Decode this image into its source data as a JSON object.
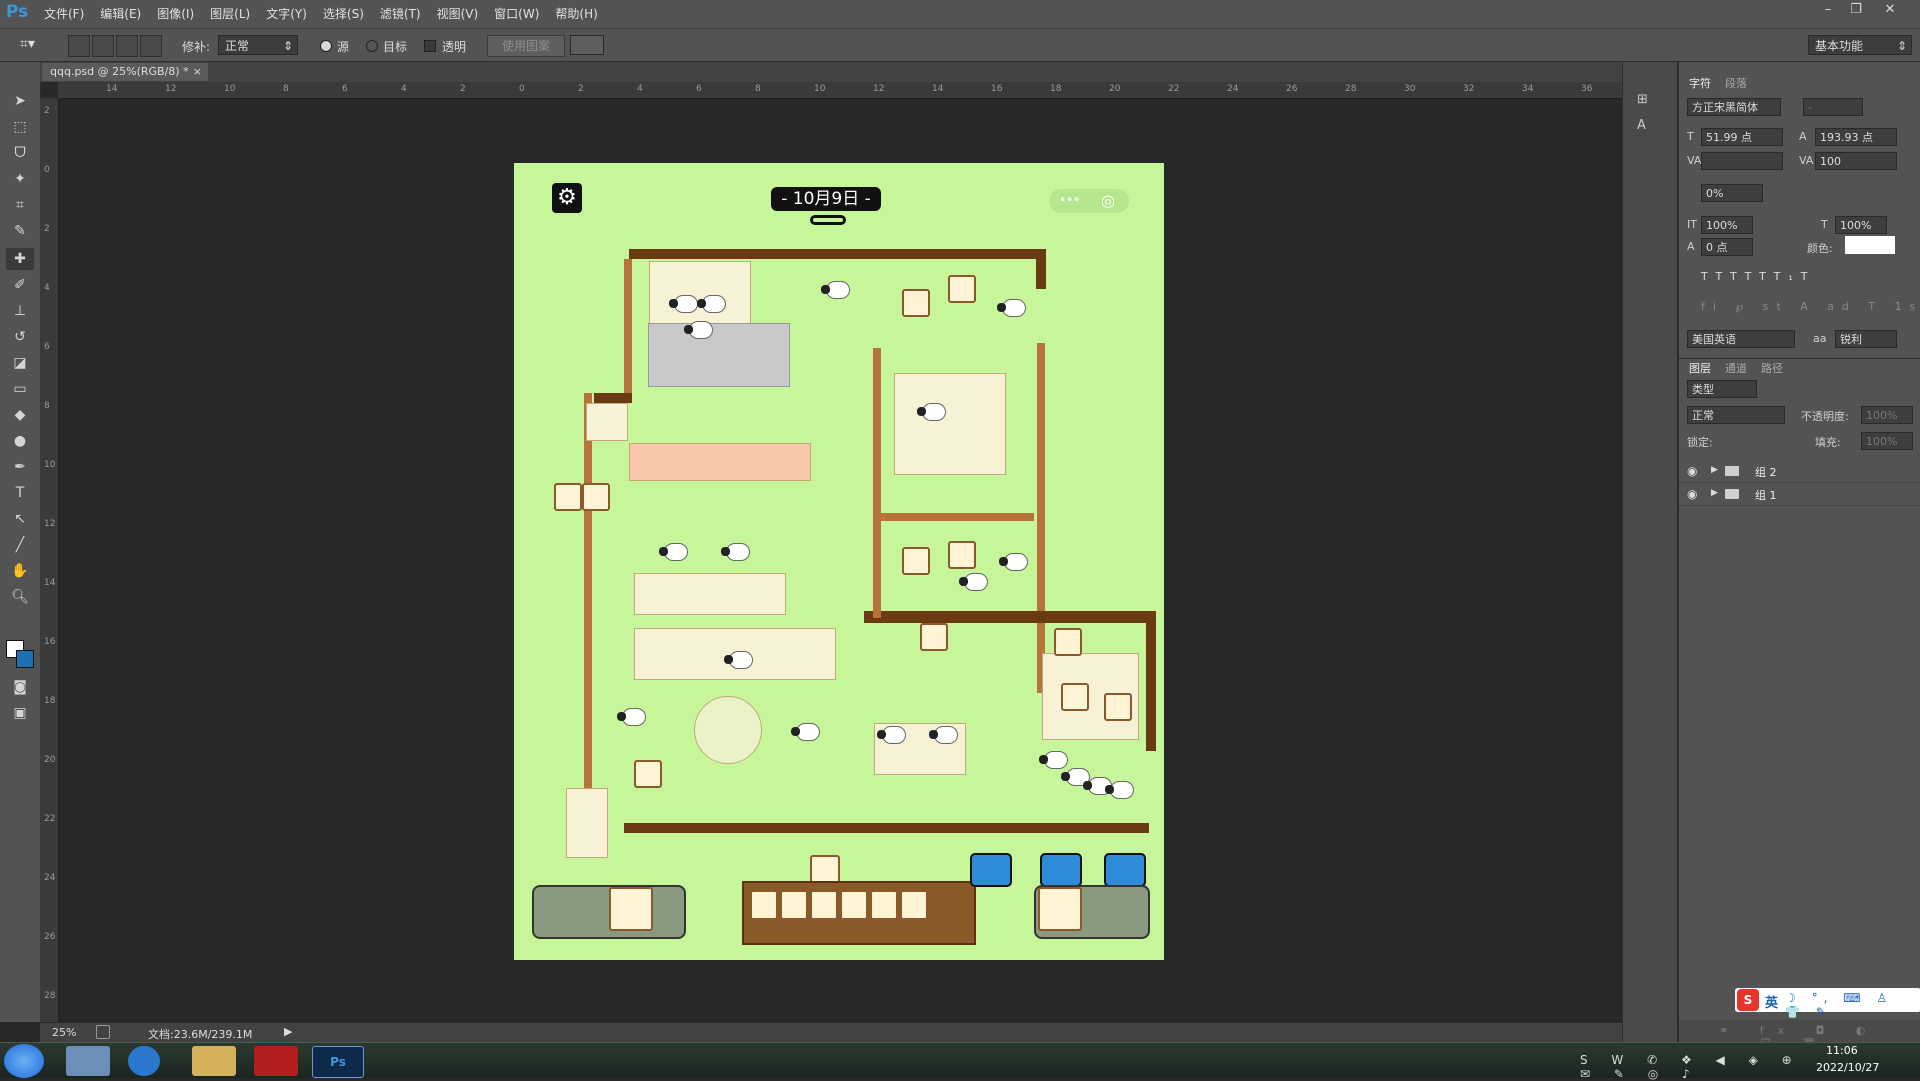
{
  "app": {
    "logo": "Ps",
    "menus": [
      "文件(F)",
      "编辑(E)",
      "图像(I)",
      "图层(L)",
      "文字(Y)",
      "选择(S)",
      "滤镜(T)",
      "视图(V)",
      "窗口(W)",
      "帮助(H)"
    ]
  },
  "options_bar": {
    "repair_label": "修补:",
    "repair_mode": "正常",
    "source_label": "源",
    "target_label": "目标",
    "transparent_label": "透明",
    "use_pattern_label": "使用图案",
    "workspace": "基本功能"
  },
  "document": {
    "tab_title": "qqq.psd @ 25%(RGB/8) *",
    "zoom": "25%",
    "doc_info": "文档:23.6M/239.1M"
  },
  "ruler": {
    "top_labels": [
      "14",
      "12",
      "10",
      "8",
      "6",
      "4",
      "2",
      "0",
      "2",
      "4",
      "6",
      "8",
      "10",
      "12",
      "14",
      "16",
      "18",
      "20",
      "22",
      "24",
      "26",
      "28",
      "30",
      "32",
      "34",
      "36"
    ],
    "left_labels": [
      "2",
      "0",
      "2",
      "4",
      "6",
      "8",
      "10",
      "12",
      "14",
      "16",
      "18",
      "20",
      "22",
      "24",
      "26",
      "28"
    ]
  },
  "game": {
    "date_label": "- 10月9日 -",
    "capsule_dots": "•••"
  },
  "character_panel": {
    "tabs": [
      "字符",
      "段落"
    ],
    "font_family": "方正宋黑简体",
    "font_style": "-",
    "font_size": "51.99 点",
    "leading": "193.93 点",
    "kerning": "",
    "tracking": "100",
    "tsume": "0%",
    "vertical_scale": "100%",
    "horizontal_scale": "100%",
    "baseline_shift": "0 点",
    "color_label": "颜色:",
    "language": "美国英语",
    "aa_label": "aa",
    "antialias": "锐利"
  },
  "layers_panel": {
    "tabs": [
      "图层",
      "通道",
      "路径"
    ],
    "filter_kind": "类型",
    "blend_mode": "正常",
    "opacity_label": "不透明度:",
    "opacity": "100%",
    "lock_label": "锁定:",
    "fill_label": "填充:",
    "fill": "100%",
    "layers": [
      "组 2",
      "组 1"
    ]
  },
  "ime": {
    "lang": "英"
  },
  "taskbar": {
    "time": "11:06",
    "date": "2022/10/27"
  },
  "colors": {
    "canvas_bg": "#c6f59a",
    "ui_dark": "#282828",
    "ui_panel": "#535353",
    "ps_blue": "#3e97d9"
  }
}
